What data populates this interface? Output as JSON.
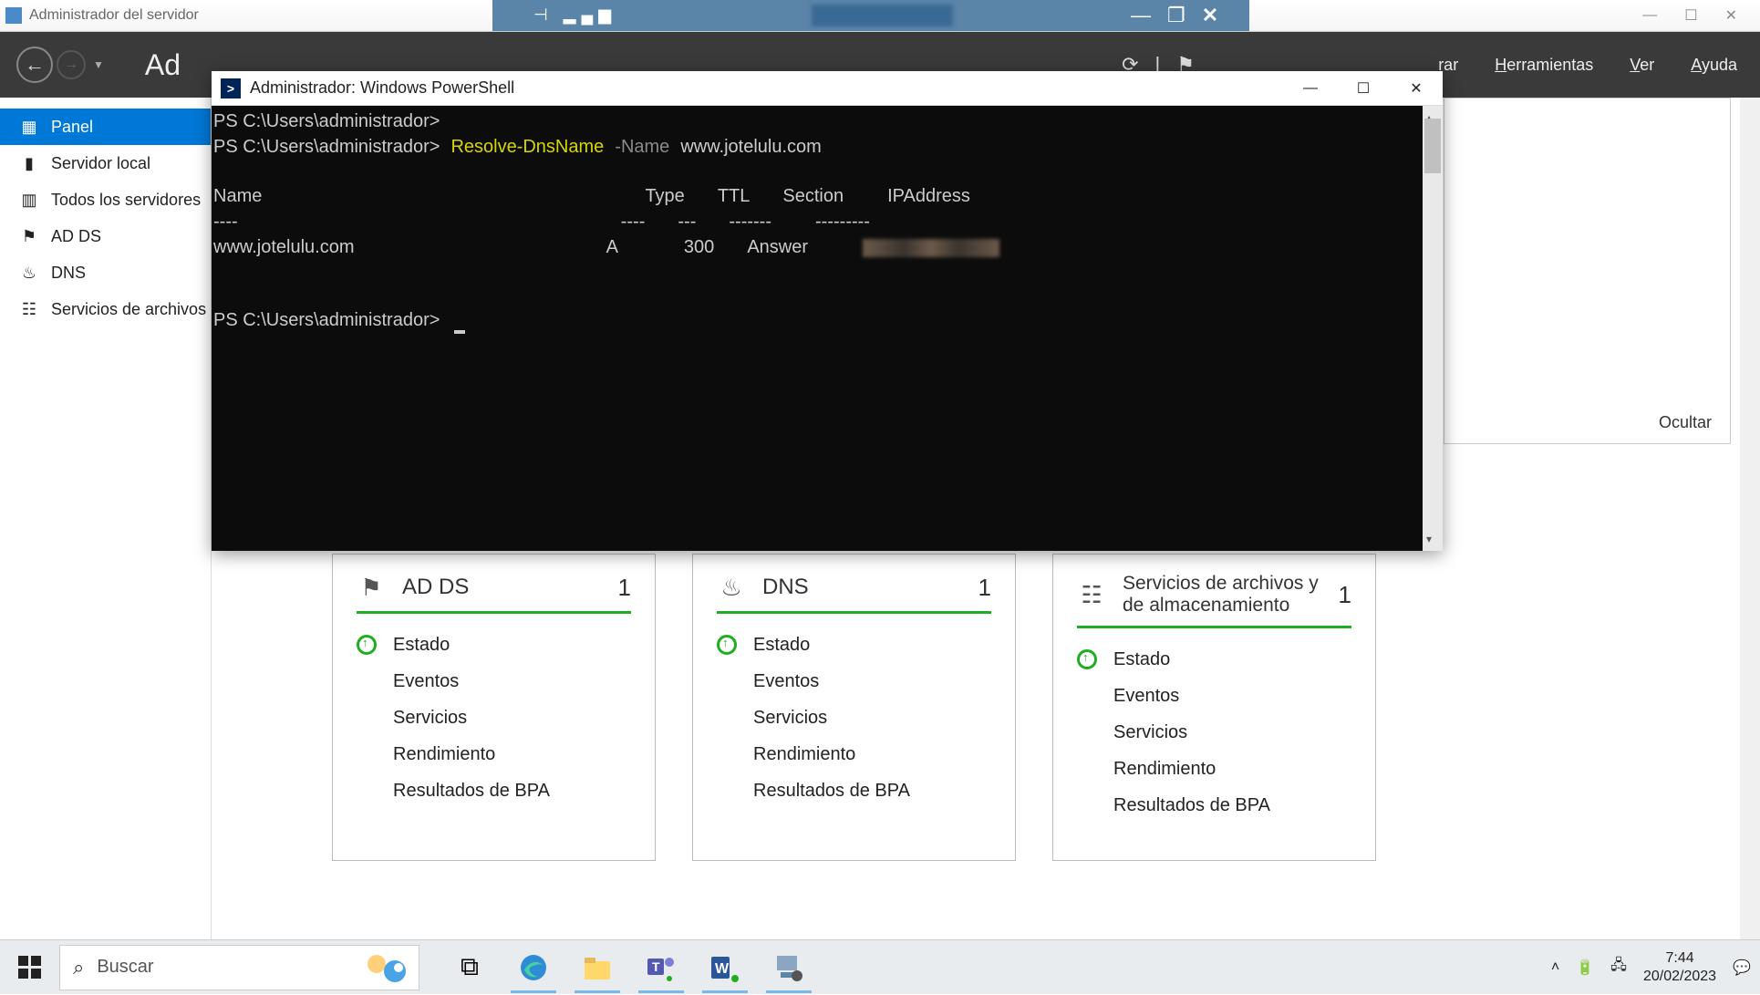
{
  "outer_window": {
    "title": "Administrador del servidor"
  },
  "sm_header": {
    "title_partial": "Ad",
    "menu": {
      "admin_partial": "rar",
      "tools": "Herramientas",
      "view": "Ver",
      "help": "Ayuda"
    }
  },
  "sidebar": {
    "items": [
      {
        "label": "Panel",
        "icon": "dashboard-icon",
        "active": true
      },
      {
        "label": "Servidor local",
        "icon": "server-icon",
        "active": false
      },
      {
        "label": "Todos los servidores",
        "icon": "servers-icon",
        "active": false
      },
      {
        "label": "AD DS",
        "icon": "adds-icon",
        "active": false
      },
      {
        "label": "DNS",
        "icon": "dns-icon",
        "active": false
      },
      {
        "label": "Servicios de archivos",
        "icon": "files-icon",
        "active": false
      }
    ]
  },
  "hide_panel": {
    "label": "Ocultar"
  },
  "tiles": [
    {
      "title": "AD DS",
      "count": "1",
      "rows": [
        "Estado",
        "Eventos",
        "Servicios",
        "Rendimiento",
        "Resultados de BPA"
      ]
    },
    {
      "title": "DNS",
      "count": "1",
      "rows": [
        "Estado",
        "Eventos",
        "Servicios",
        "Rendimiento",
        "Resultados de BPA"
      ]
    },
    {
      "title": "Servicios de archivos y de almacenamiento",
      "count": "1",
      "rows": [
        "Estado",
        "Eventos",
        "Servicios",
        "Rendimiento",
        "Resultados de BPA"
      ]
    }
  ],
  "powershell": {
    "title": "Administrador: Windows PowerShell",
    "prompt": "PS C:\\Users\\administrador>",
    "cmdlet": "Resolve-DnsName",
    "param": "-Name",
    "arg": "www.jotelulu.com",
    "columns": {
      "name": "Name",
      "type": "Type",
      "ttl": "TTL",
      "section": "Section",
      "ip": "IPAddress"
    },
    "seps": {
      "name": "----",
      "type": "----",
      "ttl": "---",
      "section": "-------",
      "ip": "---------"
    },
    "row": {
      "name": "www.jotelulu.com",
      "type": "A",
      "ttl": "300",
      "section": "Answer"
    }
  },
  "taskbar": {
    "search_placeholder": "Buscar",
    "clock": {
      "time": "7:44",
      "date": "20/02/2023"
    }
  }
}
